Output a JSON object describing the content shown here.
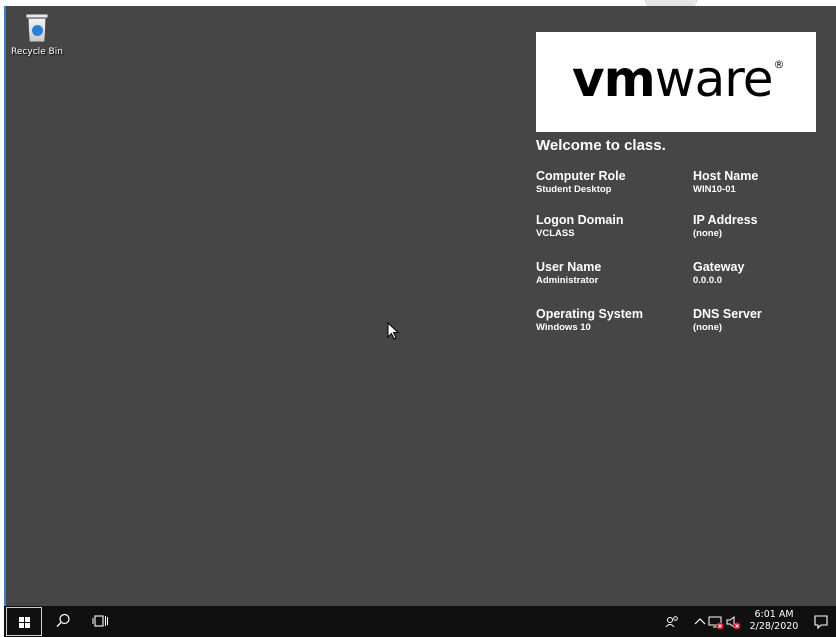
{
  "desktop": {
    "icons": [
      {
        "label": "Recycle Bin",
        "icon": "recycle-bin-icon"
      }
    ],
    "background_color": "#464646"
  },
  "bginfo": {
    "logo_text_bold": "vm",
    "logo_text_light": "ware",
    "logo_reg": "®",
    "welcome": "Welcome to class.",
    "fields": {
      "computer_role": {
        "key": "Computer Role",
        "value": "Student Desktop"
      },
      "host_name": {
        "key": "Host Name",
        "value": "WIN10-01"
      },
      "logon_domain": {
        "key": "Logon Domain",
        "value": "VCLASS"
      },
      "ip_address": {
        "key": "IP Address",
        "value": "(none)"
      },
      "user_name": {
        "key": "User Name",
        "value": "Administrator"
      },
      "gateway": {
        "key": "Gateway",
        "value": "0.0.0.0"
      },
      "operating_system": {
        "key": "Operating System",
        "value": "Windows 10"
      },
      "dns_server": {
        "key": "DNS Server",
        "value": "(none)"
      }
    }
  },
  "taskbar": {
    "start": "windows-start-icon",
    "search": "search-icon",
    "task_view": "task-view-icon",
    "tray": [
      "people-icon",
      "chevron-up-icon",
      "network-disconnected-icon",
      "volume-muted-icon"
    ],
    "time": "6:01 AM",
    "date": "2/28/2020",
    "notifications": "action-center-icon"
  },
  "colors": {
    "taskbar": "#101010",
    "accent": "#3b7fd4",
    "error": "#e81123"
  }
}
